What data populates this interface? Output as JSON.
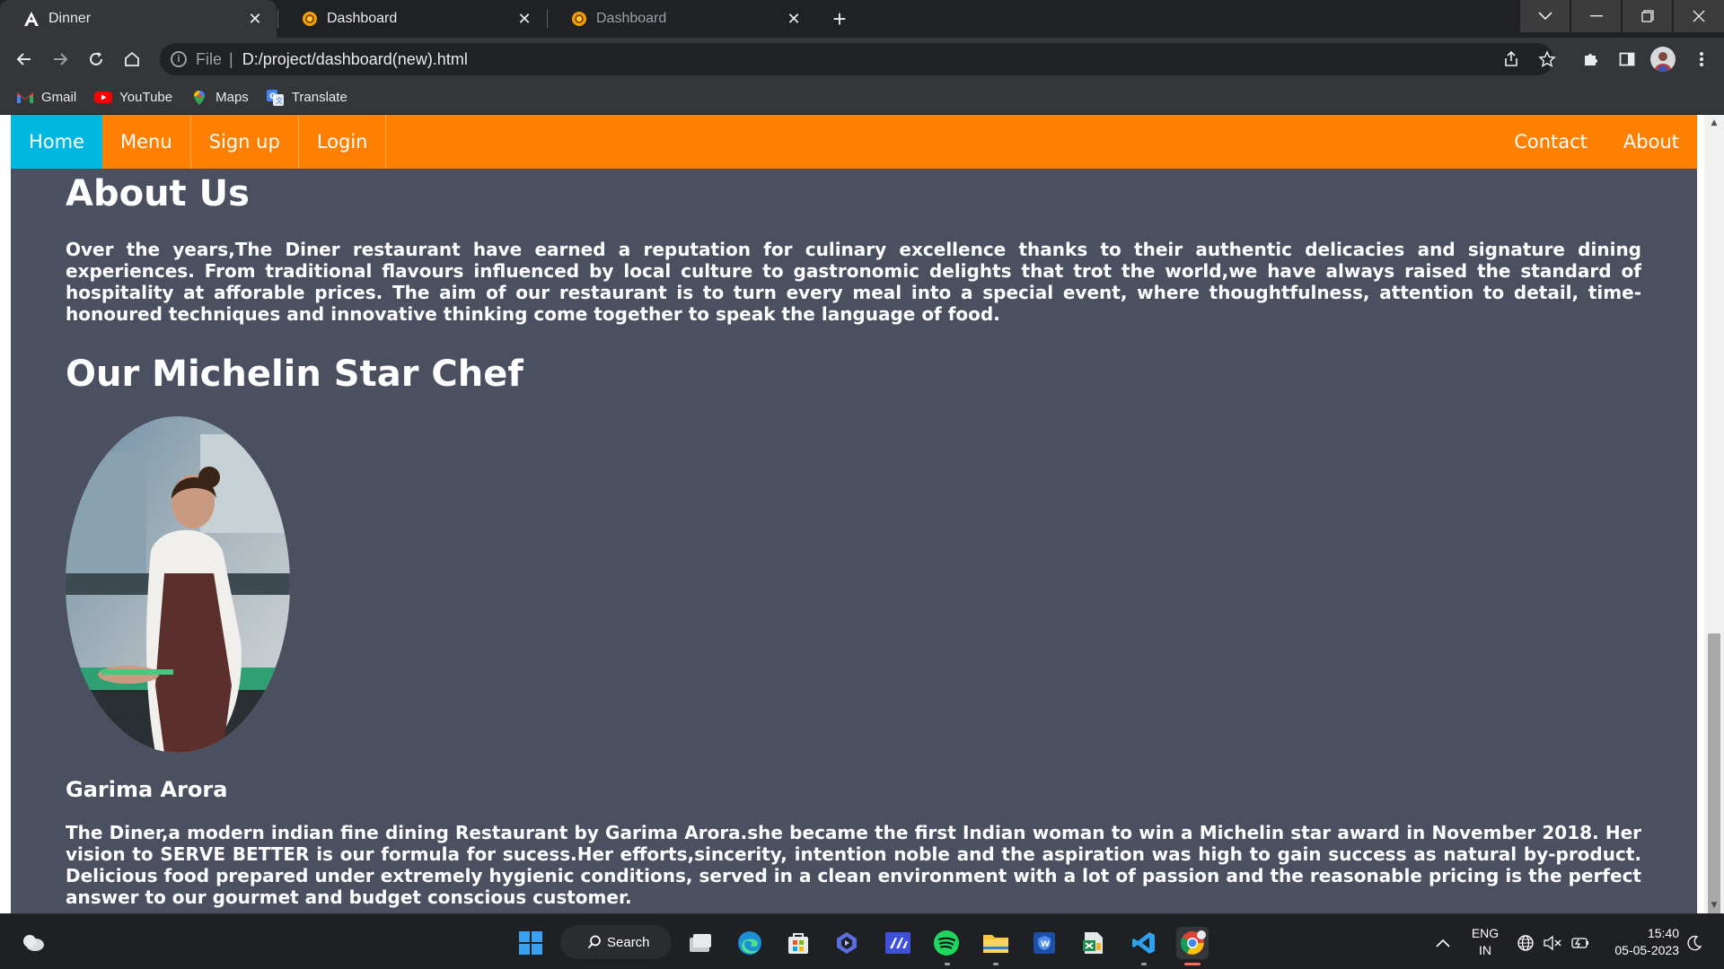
{
  "browser": {
    "tabs": [
      {
        "title": "Dinner",
        "favicon": "angular-a-icon"
      },
      {
        "title": "Dashboard",
        "favicon": "food-plate-icon"
      },
      {
        "title": "Dashboard",
        "favicon": "food-plate-icon"
      }
    ],
    "address": {
      "scheme": "File",
      "url": "D:/project/dashboard(new).html"
    },
    "bookmarks": [
      {
        "label": "Gmail",
        "icon": "gmail-icon"
      },
      {
        "label": "YouTube",
        "icon": "youtube-icon"
      },
      {
        "label": "Maps",
        "icon": "maps-icon"
      },
      {
        "label": "Translate",
        "icon": "translate-icon"
      }
    ]
  },
  "nav": {
    "left": [
      "Home",
      "Menu",
      "Sign up",
      "Login"
    ],
    "right": [
      "Contact",
      "About"
    ],
    "active": "Home",
    "colors": {
      "bar": "#ff7f00",
      "active": "#00b7e0"
    }
  },
  "about": {
    "heading": "About Us",
    "paragraph": "Over the years,The Diner restaurant have earned a reputation for culinary excellence thanks to their authentic delicacies and signature dining experiences. From traditional flavours influenced by local culture to gastronomic delights that trot the world,we have always raised the standard of hospitality at afforable prices. The aim of our restaurant is to turn every meal into a special event, where thoughtfulness, attention to detail, time-honoured techniques and innovative thinking come together to speak the language of food."
  },
  "chef": {
    "heading": "Our Michelin Star Chef",
    "name": "Garima Arora",
    "paragraph": "The Diner,a modern indian fine dining Restaurant by Garima Arora.she became the first Indian woman to win a Michelin star award in November 2018. Her vision to SERVE BETTER is our formula for sucess.Her efforts,sincerity, intention noble and the aspiration was high to gain success as natural by-product. Delicious food prepared under extremely hygienic conditions, served in a clean environment with a lot of passion and the reasonable pricing is the perfect answer to our gourmet and budget conscious customer."
  },
  "taskbar": {
    "search_label": "Search",
    "lang_line1": "ENG",
    "lang_line2": "IN",
    "time": "15:40",
    "date": "05-05-2023"
  }
}
